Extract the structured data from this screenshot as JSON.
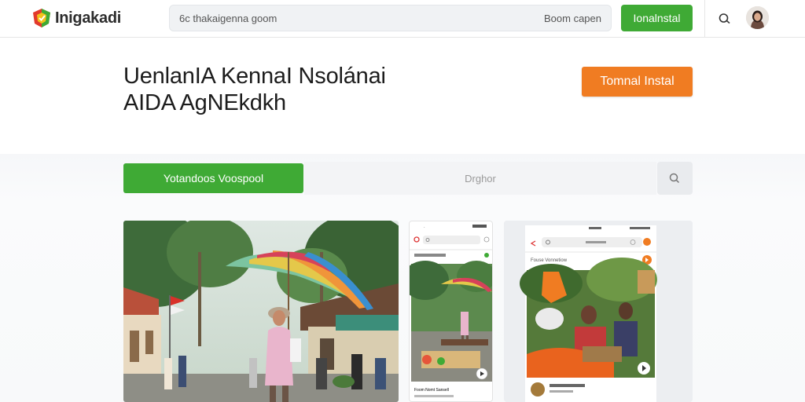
{
  "header": {
    "logo_text": "Inigakadi",
    "search": {
      "placeholder": "6c thakaigenna goom",
      "open_label": "Boom capen"
    },
    "install_label": "Ionalnstal",
    "icons": [
      "logo-icon",
      "search-icon",
      "avatar"
    ]
  },
  "hero": {
    "title_line1": "UenlanIA KennaI Nsolánai",
    "title_line2": "AIDA AgNEkdkh",
    "install_label": "Tomnal Instal"
  },
  "filter": {
    "video_button_label": "Yotandoos Voospool",
    "input_placeholder": "Drghor",
    "icons": [
      "search-icon"
    ]
  },
  "cards": [
    {
      "name": "main-photo",
      "description_icon": "umbrella-photo"
    },
    {
      "name": "phone-preview",
      "caption": "Foom Nomt Sansell"
    },
    {
      "name": "tablet-preview",
      "caption": "Fouse Vonnetiow"
    }
  ],
  "colors": {
    "green": "#3faa35",
    "orange": "#f07c22",
    "search_bg": "#f0f2f4"
  }
}
